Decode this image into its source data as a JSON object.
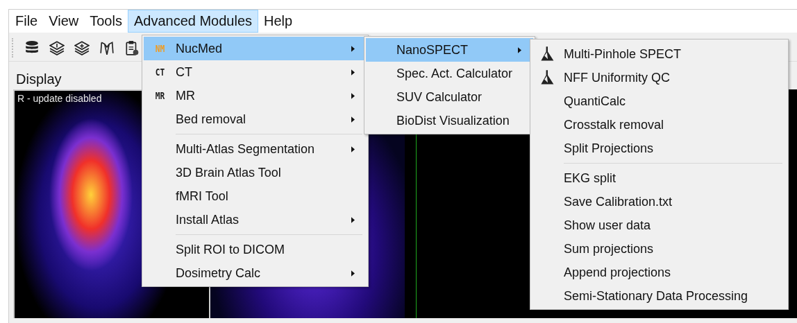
{
  "menubar": [
    {
      "label": "File",
      "selected": false
    },
    {
      "label": "View",
      "selected": false
    },
    {
      "label": "Tools",
      "selected": false
    },
    {
      "label": "Advanced Modules",
      "selected": true
    },
    {
      "label": "Help",
      "selected": false
    }
  ],
  "panel": {
    "title": "Display",
    "viewport_label": "R - update disabled"
  },
  "menus": [
    {
      "items": [
        {
          "kind": "item",
          "label": "NucMed",
          "badge": "NM",
          "color": "#f29b1d",
          "has_submenu": true,
          "selected": true
        },
        {
          "kind": "item",
          "label": "CT",
          "badge": "CT",
          "color": "#1a1a1a",
          "has_submenu": true,
          "selected": false
        },
        {
          "kind": "item",
          "label": "MR",
          "badge": "MR",
          "color": "#1a1a1a",
          "has_submenu": true,
          "selected": false
        },
        {
          "kind": "item",
          "label": "Bed removal",
          "has_submenu": true,
          "selected": false
        },
        {
          "kind": "separator"
        },
        {
          "kind": "item",
          "label": "Multi-Atlas Segmentation",
          "has_submenu": true,
          "selected": false
        },
        {
          "kind": "item",
          "label": "3D Brain Atlas Tool",
          "has_submenu": false,
          "selected": false
        },
        {
          "kind": "item",
          "label": "fMRI Tool",
          "has_submenu": false,
          "selected": false
        },
        {
          "kind": "item",
          "label": "Install Atlas",
          "has_submenu": true,
          "selected": false
        },
        {
          "kind": "separator"
        },
        {
          "kind": "item",
          "label": "Split ROI to DICOM",
          "has_submenu": false,
          "selected": false
        },
        {
          "kind": "item",
          "label": "Dosimetry Calc",
          "has_submenu": true,
          "selected": false
        }
      ]
    },
    {
      "items": [
        {
          "kind": "item",
          "label": "NanoSPECT",
          "has_submenu": true,
          "selected": true
        },
        {
          "kind": "item",
          "label": "Spec. Act. Calculator",
          "has_submenu": false,
          "selected": false
        },
        {
          "kind": "item",
          "label": "SUV Calculator",
          "has_submenu": false,
          "selected": false
        },
        {
          "kind": "item",
          "label": "BioDist Visualization",
          "has_submenu": false,
          "selected": false
        }
      ]
    },
    {
      "items": [
        {
          "kind": "item",
          "label": "Multi-Pinhole SPECT",
          "has_icon": true,
          "has_submenu": false,
          "selected": false
        },
        {
          "kind": "item",
          "label": "NFF Uniformity QC",
          "has_icon": true,
          "has_submenu": false,
          "selected": false
        },
        {
          "kind": "item",
          "label": "QuantiCalc",
          "has_submenu": false,
          "selected": false
        },
        {
          "kind": "item",
          "label": "Crosstalk removal",
          "has_submenu": false,
          "selected": false
        },
        {
          "kind": "item",
          "label": "Split Projections",
          "has_submenu": false,
          "selected": false
        },
        {
          "kind": "separator"
        },
        {
          "kind": "item",
          "label": "EKG split",
          "has_submenu": false,
          "selected": false
        },
        {
          "kind": "item",
          "label": "Save Calibration.txt",
          "has_submenu": false,
          "selected": false
        },
        {
          "kind": "item",
          "label": "Show user data",
          "has_submenu": false,
          "selected": false
        },
        {
          "kind": "item",
          "label": "Sum projections",
          "has_submenu": false,
          "selected": false
        },
        {
          "kind": "item",
          "label": "Append projections",
          "has_submenu": false,
          "selected": false
        },
        {
          "kind": "item",
          "label": "Semi-Stationary Data Processing",
          "has_submenu": false,
          "selected": false
        }
      ]
    }
  ]
}
